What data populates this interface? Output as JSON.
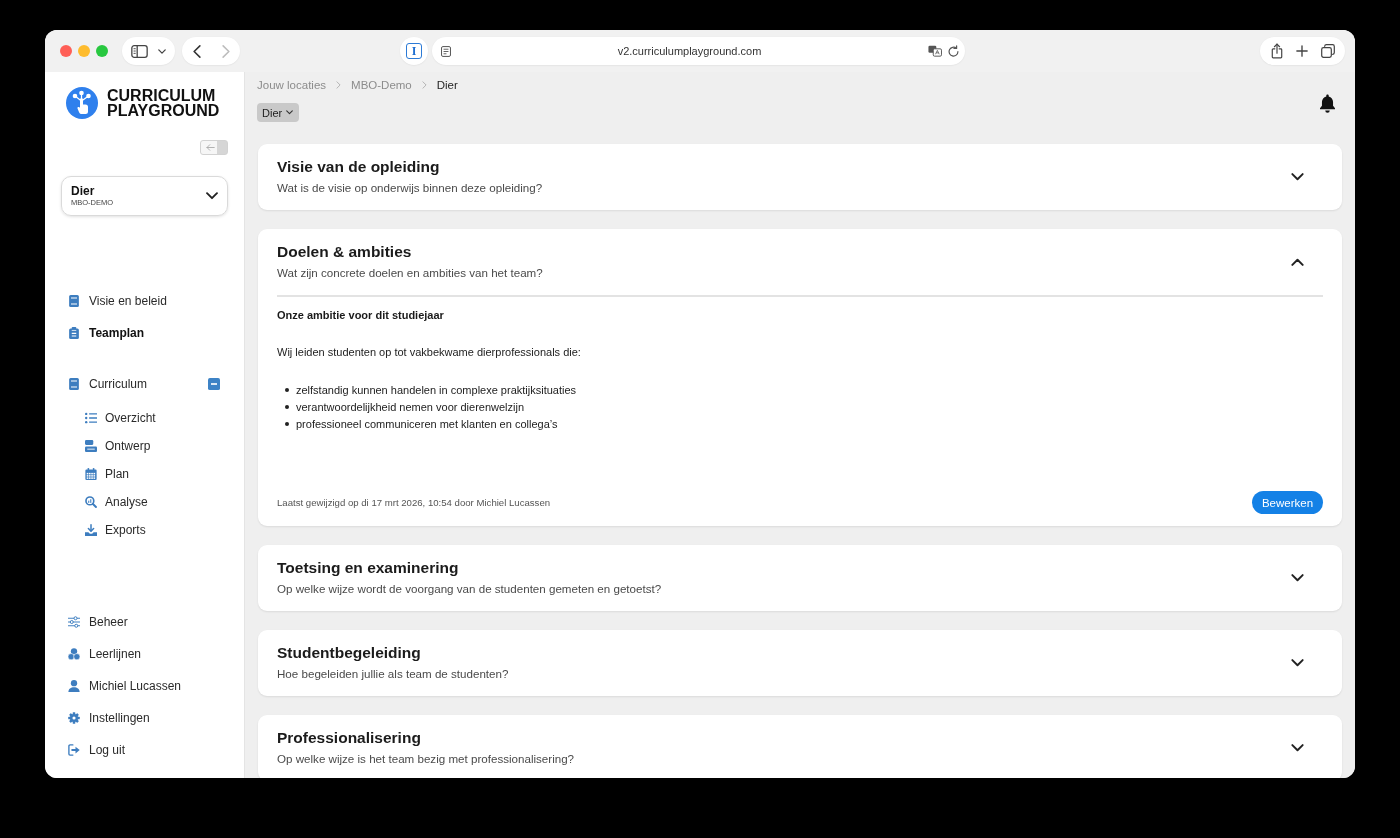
{
  "browser": {
    "url": "v2.curriculumplayground.com",
    "extension_badge": "I",
    "back_enabled": true,
    "forward_enabled": false
  },
  "sidebar": {
    "logo": [
      "CURRICULUM",
      "PLAYGROUND"
    ],
    "location_picker": {
      "name": "Dier",
      "code": "MBO-DEMO"
    },
    "primary_nav": [
      {
        "label": "Visie en beleid",
        "selected": false
      },
      {
        "label": "Teamplan",
        "selected": true
      }
    ],
    "curriculum": {
      "label": "Curriculum",
      "selected": false,
      "expanded": true,
      "children": [
        {
          "label": "Overzicht",
          "selected": false
        },
        {
          "label": "Ontwerp",
          "selected": false
        },
        {
          "label": "Plan",
          "selected": false
        },
        {
          "label": "Analyse",
          "selected": false
        },
        {
          "label": "Exports",
          "selected": false
        }
      ]
    },
    "footer_nav": [
      {
        "label": "Beheer",
        "selected": false
      },
      {
        "label": "Leerlijnen",
        "selected": false
      },
      {
        "label": "Michiel Lucassen",
        "selected": false
      },
      {
        "label": "Instellingen",
        "selected": false
      },
      {
        "label": "Log uit",
        "selected": false
      }
    ]
  },
  "breadcrumb": [
    "Jouw locaties",
    "MBO-Demo",
    "Dier"
  ],
  "location_chip": "Dier",
  "sections": [
    {
      "title": "Visie van de opleiding",
      "subtitle": "Wat is de visie op onderwijs binnen deze opleiding?",
      "expanded": false
    },
    {
      "title": "Doelen & ambities",
      "subtitle": "Wat zijn concrete doelen en ambities van het team?",
      "expanded": true,
      "content": {
        "heading": "Onze ambitie voor dit studiejaar",
        "paragraph": "Wij leiden studenten op tot vakbekwame dierprofessionals die:",
        "bullets": [
          "zelfstandig kunnen handelen in complexe praktijksituaties",
          "verantwoordelijkheid nemen voor dierenwelzijn",
          "professioneel communiceren met klanten en collega’s"
        ],
        "last_modified": "Laatst gewijzigd op di 17 mrt 2026, 10:54 door Michiel Lucassen",
        "edit_button": "Bewerken"
      }
    },
    {
      "title": "Toetsing en examinering",
      "subtitle": "Op welke wijze wordt de voorgang van de studenten gemeten en getoetst?",
      "expanded": false
    },
    {
      "title": "Studentbegeleiding",
      "subtitle": "Hoe begeleiden jullie als team de studenten?",
      "expanded": false
    },
    {
      "title": "Professionalisering",
      "subtitle": "Op welke wijze is het team bezig met professionalisering?",
      "expanded": false
    }
  ]
}
